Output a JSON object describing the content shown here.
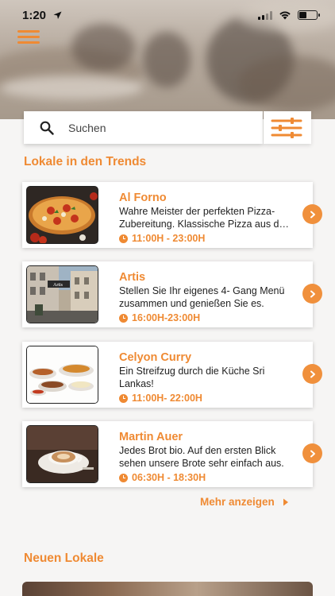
{
  "status_bar": {
    "time": "1:20"
  },
  "search": {
    "placeholder": "Suchen"
  },
  "sections": {
    "trending_title": "Lokale in den Trends",
    "new_title": "Neuen Lokale"
  },
  "restaurants": [
    {
      "name": "Al Forno",
      "description": "Wahre Meister der perfekten Pizza-Zubereitung. Klassische Pizza aus dem Steinofen.",
      "hours": "11:00H - 23:00H"
    },
    {
      "name": "Artis",
      "description": "Stellen Sie Ihr eigenes 4- Gang Menü zusammen und genießen Sie es.",
      "hours": "16:00H-23:00H"
    },
    {
      "name": "Celyon Curry",
      "description": "Ein Streifzug durch die Küche Sri Lankas!",
      "hours": "11:00H- 22:00H"
    },
    {
      "name": "Martin Auer",
      "description": "Jedes Brot bio. Auf den ersten Blick sehen unsere Brote sehr einfach aus.",
      "hours": "06:30H - 18:30H"
    }
  ],
  "more_label": "Mehr anzeigen",
  "colors": {
    "accent": "#ef8a33",
    "background": "#f6f5f4"
  },
  "icons": [
    "menu-icon",
    "search-icon",
    "filter-icon",
    "clock-icon",
    "chevron-right-icon",
    "wifi-icon",
    "battery-icon",
    "location-arrow-icon"
  ]
}
